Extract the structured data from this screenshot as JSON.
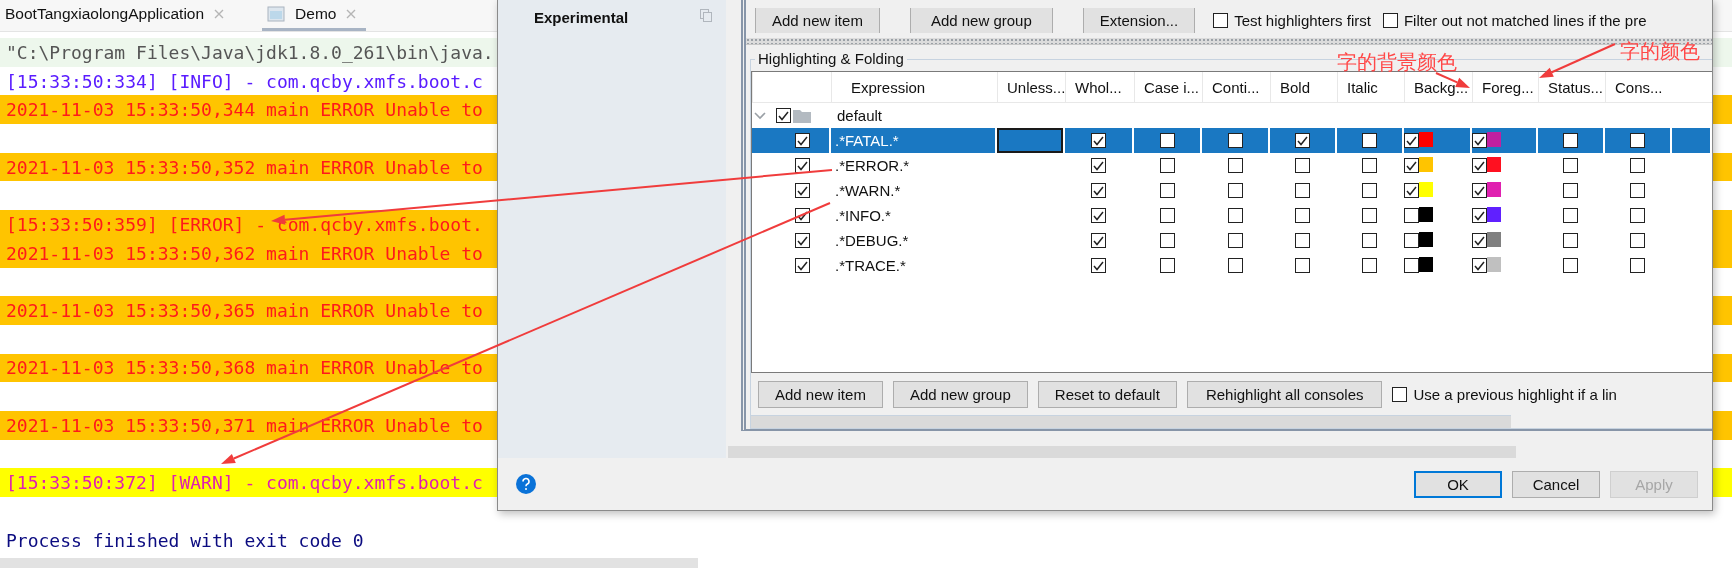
{
  "tabs": [
    {
      "label": "BootTangxiaolongApplication",
      "selected": false
    },
    {
      "label": "Demo",
      "selected": true
    }
  ],
  "console": {
    "lines": [
      {
        "kind": "cmd",
        "text": "\"C:\\Program Files\\Java\\jdk1.8.0_261\\bin\\java."
      },
      {
        "kind": "info",
        "text": "[15:33:50:334] [INFO] - com.qcby.xmfs.boot.c"
      },
      {
        "kind": "error",
        "text": "2021-11-03 15:33:50,344 main ERROR Unable to"
      },
      {
        "kind": "blank"
      },
      {
        "kind": "error",
        "text": "2021-11-03 15:33:50,352 main ERROR Unable to"
      },
      {
        "kind": "blank"
      },
      {
        "kind": "error",
        "text": "[15:33:50:359] [ERROR] - com.qcby.xmfs.boot."
      },
      {
        "kind": "error",
        "text": "2021-11-03 15:33:50,362 main ERROR Unable to"
      },
      {
        "kind": "blank"
      },
      {
        "kind": "error",
        "text": "2021-11-03 15:33:50,365 main ERROR Unable to"
      },
      {
        "kind": "blank"
      },
      {
        "kind": "error",
        "text": "2021-11-03 15:33:50,368 main ERROR Unable to"
      },
      {
        "kind": "blank"
      },
      {
        "kind": "error",
        "text": "2021-11-03 15:33:50,371 main ERROR Unable to"
      },
      {
        "kind": "blank"
      },
      {
        "kind": "warn",
        "text": "[15:33:50:372] [WARN] - com.qcby.xmfs.boot.c"
      },
      {
        "kind": "blank"
      },
      {
        "kind": "process",
        "text": "Process finished with exit code 0"
      }
    ]
  },
  "dialog": {
    "sidebar": {
      "title": "Experimental"
    },
    "toolbar": {
      "buttons": [
        "Add new item",
        "Add new group",
        "Extension..."
      ],
      "options": [
        {
          "label": "Test highlighters first",
          "checked": false
        },
        {
          "label": "Filter out not matched lines if the pre",
          "checked": false
        }
      ]
    },
    "group_title": "Highlighting & Folding",
    "table": {
      "columns": [
        "Expression",
        "Unless...",
        "Whol...",
        "Case i...",
        "Conti...",
        "Bold",
        "Italic",
        "Backg...",
        "Foreg...",
        "Status...",
        "Cons..."
      ],
      "group": {
        "label": "default",
        "checked": true,
        "expanded": true
      },
      "rows": [
        {
          "enabled": true,
          "expression": ".*FATAL.*",
          "selected": true,
          "whole": true,
          "case": false,
          "continue": false,
          "bold": true,
          "italic": false,
          "background": {
            "checked": true,
            "color": "#ff0000"
          },
          "foreground": {
            "checked": true,
            "color": "#c020a0"
          },
          "status": false,
          "console": false
        },
        {
          "enabled": true,
          "expression": ".*ERROR.*",
          "selected": false,
          "whole": true,
          "case": false,
          "continue": false,
          "bold": false,
          "italic": false,
          "background": {
            "checked": true,
            "color": "#ffc400"
          },
          "foreground": {
            "checked": true,
            "color": "#ff1020"
          },
          "status": false,
          "console": false
        },
        {
          "enabled": true,
          "expression": ".*WARN.*",
          "selected": false,
          "whole": true,
          "case": false,
          "continue": false,
          "bold": false,
          "italic": false,
          "background": {
            "checked": true,
            "color": "#ffff00"
          },
          "foreground": {
            "checked": true,
            "color": "#e020b0"
          },
          "status": false,
          "console": false
        },
        {
          "enabled": true,
          "expression": ".*INFO.*",
          "selected": false,
          "whole": true,
          "case": false,
          "continue": false,
          "bold": false,
          "italic": false,
          "background": {
            "checked": false,
            "color": "#000000"
          },
          "foreground": {
            "checked": true,
            "color": "#6020ff"
          },
          "status": false,
          "console": false
        },
        {
          "enabled": true,
          "expression": ".*DEBUG.*",
          "selected": false,
          "whole": true,
          "case": false,
          "continue": false,
          "bold": false,
          "italic": false,
          "background": {
            "checked": false,
            "color": "#000000"
          },
          "foreground": {
            "checked": true,
            "color": "#808080"
          },
          "status": false,
          "console": false
        },
        {
          "enabled": true,
          "expression": ".*TRACE.*",
          "selected": false,
          "whole": true,
          "case": false,
          "continue": false,
          "bold": false,
          "italic": false,
          "background": {
            "checked": false,
            "color": "#000000"
          },
          "foreground": {
            "checked": true,
            "color": "#c0c0c0"
          },
          "status": false,
          "console": false
        }
      ]
    },
    "bottom": {
      "buttons": [
        "Add new item",
        "Add new group",
        "Reset to default",
        "Rehighlight all consoles"
      ],
      "option": {
        "label": "Use a previous highlight if a lin",
        "checked": false
      }
    },
    "footer": {
      "buttons": [
        {
          "label": "OK",
          "default": true,
          "disabled": false
        },
        {
          "label": "Cancel",
          "default": false,
          "disabled": false
        },
        {
          "label": "Apply",
          "default": false,
          "disabled": true
        }
      ]
    }
  },
  "annotations": [
    {
      "text": "字的背景颜色"
    },
    {
      "text": "字的颜色"
    }
  ]
}
